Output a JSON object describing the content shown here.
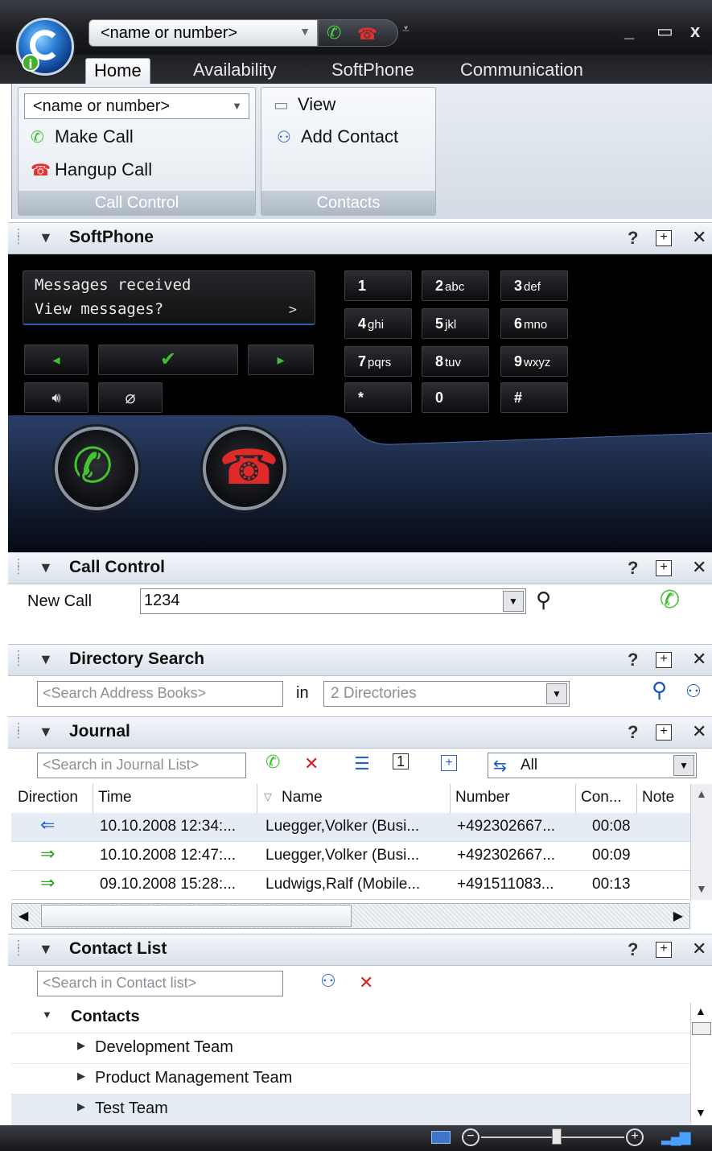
{
  "titlebar": {
    "combo_value": "<name or number>",
    "minimize": "_",
    "maximize": "▭",
    "close": "x"
  },
  "ribbon": {
    "tabs": [
      "Home",
      "Availability",
      "SoftPhone",
      "Communication"
    ],
    "active_tab": "Home",
    "call_control": {
      "combo_value": "<name or number>",
      "make_call": "Make Call",
      "hangup_call": "Hangup Call",
      "group_label": "Call Control"
    },
    "contacts": {
      "view": "View",
      "add_contact": "Add Contact",
      "group_label": "Contacts"
    }
  },
  "softphone": {
    "title": "SoftPhone",
    "lcd_line1": "Messages received",
    "lcd_line2": "View messages?",
    "lcd_arrow": ">",
    "keys": [
      {
        "digit": "1",
        "letters": ""
      },
      {
        "digit": "2",
        "letters": "abc"
      },
      {
        "digit": "3",
        "letters": "def"
      },
      {
        "digit": "4",
        "letters": "ghi"
      },
      {
        "digit": "5",
        "letters": "jkl"
      },
      {
        "digit": "6",
        "letters": "mno"
      },
      {
        "digit": "7",
        "letters": "pqrs"
      },
      {
        "digit": "8",
        "letters": "tuv"
      },
      {
        "digit": "9",
        "letters": "wxyz"
      },
      {
        "digit": "*",
        "letters": ""
      },
      {
        "digit": "0",
        "letters": ""
      },
      {
        "digit": "#",
        "letters": ""
      }
    ]
  },
  "call_control": {
    "title": "Call Control",
    "label": "New Call",
    "value": "1234"
  },
  "directory_search": {
    "title": "Directory Search",
    "placeholder": "<Search Address Books>",
    "in_label": "in",
    "directories": "2 Directories"
  },
  "journal": {
    "title": "Journal",
    "placeholder": "<Search in Journal List>",
    "filter": "All",
    "columns": [
      "Direction",
      "Time",
      "Name",
      "Number",
      "Con...",
      "Note"
    ],
    "rows": [
      {
        "direction": "incoming",
        "time": "10.10.2008  12:34:...",
        "name": "Luegger,Volker  (Busi...",
        "number": "+492302667...",
        "duration": "00:08",
        "note": ""
      },
      {
        "direction": "outgoing",
        "time": "10.10.2008  12:47:...",
        "name": "Luegger,Volker  (Busi...",
        "number": "+492302667...",
        "duration": "00:09",
        "note": ""
      },
      {
        "direction": "outgoing",
        "time": "09.10.2008  15:28:...",
        "name": "Ludwigs,Ralf  (Mobile...",
        "number": "+491511083...",
        "duration": "00:13",
        "note": ""
      }
    ]
  },
  "contact_list": {
    "title": "Contact List",
    "placeholder": "<Search in Contact list>",
    "root": "Contacts",
    "groups": [
      "Development Team",
      "Product Management Team",
      "Test Team"
    ]
  },
  "colors": {
    "accept_green": "#3fc02e",
    "hangup_red": "#e23030",
    "link_blue": "#1b56b8"
  }
}
